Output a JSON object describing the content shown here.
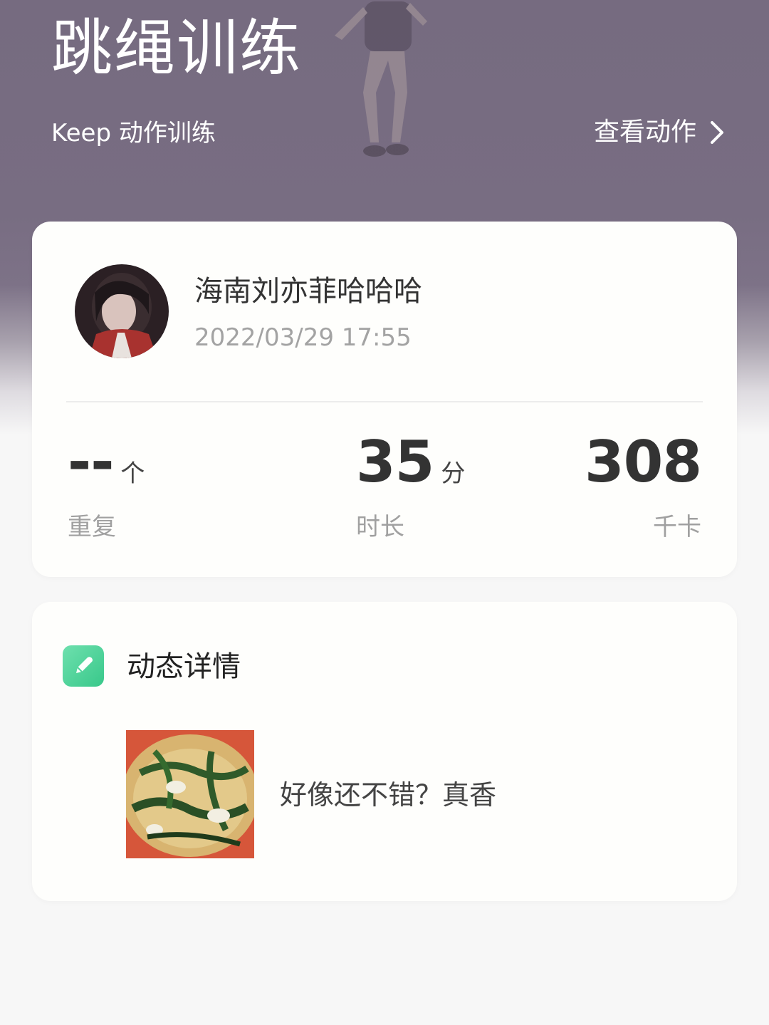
{
  "header": {
    "title": "跳绳训练",
    "subtitle": "Keep 动作训练",
    "view_action_label": "查看动作",
    "view_action_icon": "chevron-right-icon"
  },
  "workout": {
    "user_name": "海南刘亦菲哈哈哈",
    "datetime": "2022/03/29 17:55",
    "stats": {
      "reps": {
        "value": "--",
        "unit": "个",
        "label": "重复"
      },
      "duration": {
        "value": "35",
        "unit": "分",
        "label": "时长"
      },
      "calories": {
        "value": "308",
        "unit": "",
        "label": "千卡"
      }
    }
  },
  "feed": {
    "title": "动态详情",
    "icon": "edit-pencil-icon",
    "icon_color": "#4fd49b",
    "caption": "好像还不错？真香"
  }
}
